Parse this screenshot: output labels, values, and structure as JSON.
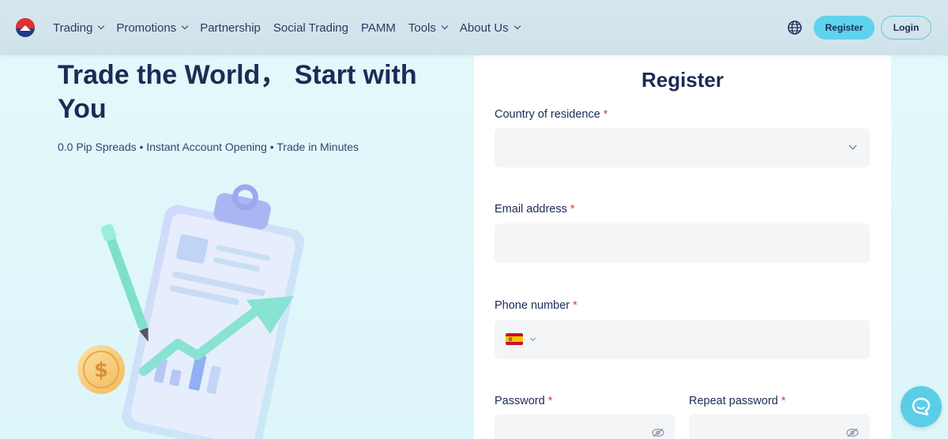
{
  "nav": {
    "items": [
      {
        "label": "Trading",
        "dropdown": true
      },
      {
        "label": "Promotions",
        "dropdown": true
      },
      {
        "label": "Partnership",
        "dropdown": false
      },
      {
        "label": "Social Trading",
        "dropdown": false
      },
      {
        "label": "PAMM",
        "dropdown": false
      },
      {
        "label": "Tools",
        "dropdown": true
      },
      {
        "label": "About Us",
        "dropdown": true
      }
    ],
    "register_label": "Register",
    "login_label": "Login"
  },
  "hero": {
    "title": "Trade the World， Start with You",
    "subtitle": "0.0 Pip Spreads • Instant Account Opening • Trade in Minutes"
  },
  "form": {
    "title": "Register",
    "country_label": "Country of residence",
    "country_value": "",
    "email_label": "Email address",
    "email_value": "",
    "phone_label": "Phone number",
    "phone_value": "",
    "phone_country": "Spain",
    "password_label": "Password",
    "repeat_password_label": "Repeat password",
    "required_marker": "*"
  },
  "icons": {
    "globe": "globe-icon",
    "chat": "chat-icon",
    "eye_off": "eye-off-icon",
    "flag": "spain-flag-icon"
  },
  "colors": {
    "accent": "#5ed3ec",
    "navy": "#1d2b55",
    "required": "#d14343"
  }
}
